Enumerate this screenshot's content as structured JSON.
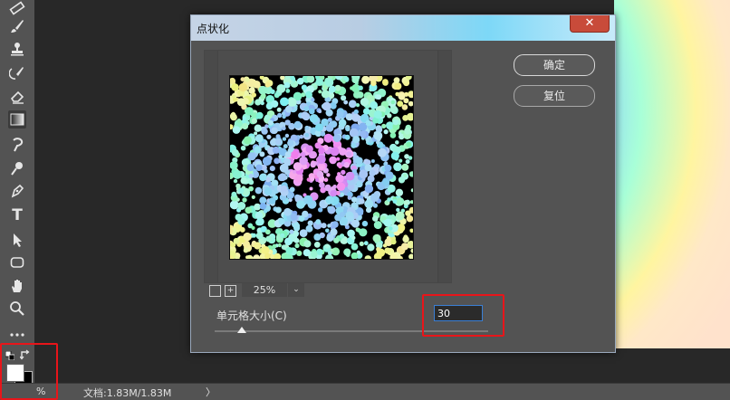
{
  "dialog": {
    "title": "点状化",
    "close_glyph": "✕",
    "ok_label": "确定",
    "reset_label": "复位",
    "zoom_value": "25%",
    "zoom_dropdown_glyph": "⌄",
    "zoom_out_glyph": "",
    "zoom_in_glyph": "+",
    "cell_size_label": "单元格大小(C)",
    "cell_size_value": "30",
    "cell_size_slider_fraction": 0.1
  },
  "statusbar": {
    "zoom_readout": "%",
    "doc_info": "文档:1.83M/1.83M",
    "arrow_glyph": "〉"
  },
  "toolbar": {
    "items": [
      {
        "name": "ruler-icon",
        "active": false
      },
      {
        "name": "brush-icon",
        "active": false
      },
      {
        "name": "clone-stamp-icon",
        "active": false
      },
      {
        "name": "history-brush-icon",
        "active": false
      },
      {
        "name": "eraser-icon",
        "active": false
      },
      {
        "name": "gradient-icon",
        "active": true
      },
      {
        "name": "smudge-icon",
        "active": false
      },
      {
        "name": "dodge-icon",
        "active": false
      },
      {
        "name": "pen-icon",
        "active": false
      },
      {
        "name": "text-icon",
        "active": false
      },
      {
        "name": "path-selection-icon",
        "active": false
      },
      {
        "name": "rectangle-icon",
        "active": false
      },
      {
        "name": "hand-icon",
        "active": false
      },
      {
        "name": "zoom-icon",
        "active": false
      },
      {
        "name": "more-icon",
        "active": false
      }
    ],
    "text_tool_glyph": "T"
  },
  "colors": {
    "foreground": "#ffffff",
    "background": "#000000",
    "highlight": "#e8151a",
    "accent": "#3a7fd5"
  }
}
